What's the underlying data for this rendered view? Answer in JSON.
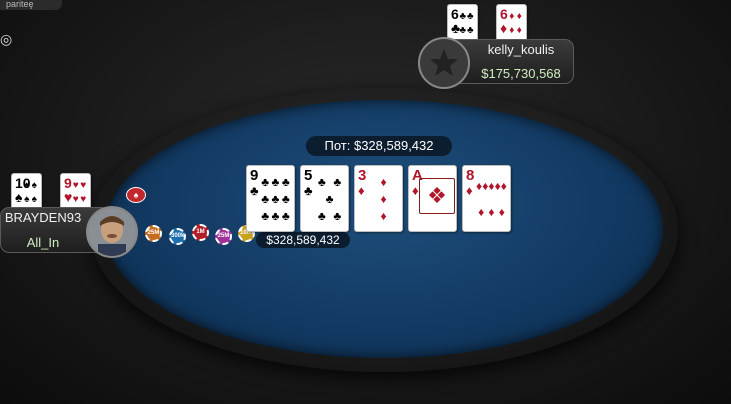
{
  "window": {
    "top_tab_label": "pariteȩ"
  },
  "pot": {
    "label": "Пот: $328,589,432"
  },
  "board": [
    {
      "rank": "9",
      "suit": "♣",
      "color": "black",
      "pips": [
        "♣",
        "♣",
        "♣",
        "♣",
        "♣",
        "♣",
        "♣",
        "♣",
        "♣"
      ]
    },
    {
      "rank": "5",
      "suit": "♣",
      "color": "black",
      "pips": [
        "♣",
        "♣",
        "♣",
        "♣",
        "♣"
      ]
    },
    {
      "rank": "3",
      "suit": "♦",
      "color": "red",
      "pips": [
        "♦",
        "♦",
        "♦"
      ]
    },
    {
      "rank": "A",
      "suit": "♦",
      "color": "red",
      "pips": [
        "♦"
      ]
    },
    {
      "rank": "8",
      "suit": "♦",
      "color": "red",
      "pips": [
        "♦",
        "♦",
        "♦",
        "♦",
        "♦",
        "♦",
        "♦",
        "♦"
      ]
    }
  ],
  "players": {
    "top": {
      "name": "kelly_koulis",
      "stack": "$175,730,568",
      "cards": [
        {
          "rank": "6",
          "suit": "♣",
          "color": "black"
        },
        {
          "rank": "6",
          "suit": "♦",
          "color": "red"
        }
      ]
    },
    "left": {
      "name": "BRAYDEN93",
      "stack": "All_In",
      "cards": [
        {
          "rank": "10",
          "suit": "♠",
          "color": "black"
        },
        {
          "rank": "9",
          "suit": "♥",
          "color": "red"
        }
      ],
      "bet": "$328,589,432"
    }
  },
  "chips": [
    "25M",
    "300k",
    "1M",
    "25M",
    "100M"
  ],
  "colors": {
    "felt": "#123a63",
    "stack_text": "#cfeec0",
    "red_suit": "#b0152a"
  }
}
